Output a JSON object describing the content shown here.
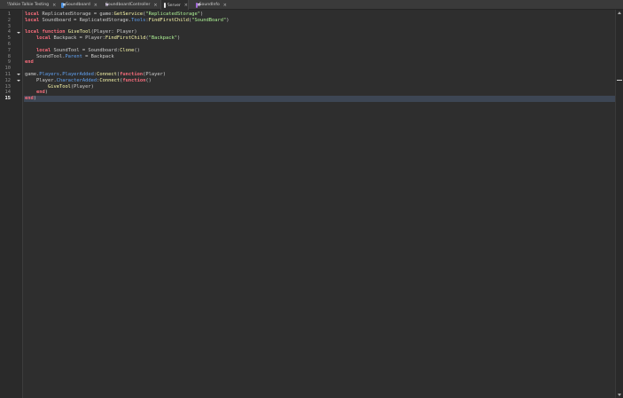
{
  "tabs": [
    {
      "label": "Walkie Talkie Testing",
      "icon": "script-icon",
      "close": "×"
    },
    {
      "label": "Soundboard",
      "icon": "local-script-icon",
      "close": "×"
    },
    {
      "label": "SoundboardController",
      "icon": "module-script-icon",
      "close": "×"
    },
    {
      "label": "Server",
      "icon": "script-icon",
      "close": "×",
      "active": true
    },
    {
      "label": "SoundInfo",
      "icon": "module-script-icon",
      "close": "×"
    }
  ],
  "editor": {
    "current_line": 15,
    "line_numbers": [
      "1",
      "2",
      "3",
      "4",
      "5",
      "6",
      "7",
      "8",
      "9",
      "10",
      "11",
      "12",
      "13",
      "14",
      "15"
    ],
    "lines": [
      [
        [
          "kw",
          "local"
        ],
        [
          "pl",
          " ReplicatedStorage = "
        ],
        [
          "pl",
          "game"
        ],
        [
          "pl",
          ":"
        ],
        [
          "fn",
          "GetService"
        ],
        [
          "pl",
          "("
        ],
        [
          "str",
          "\"ReplicatedStorage\""
        ],
        [
          "pl",
          ")"
        ]
      ],
      [
        [
          "kw",
          "local"
        ],
        [
          "pl",
          " Soundboard = ReplicatedStorage."
        ],
        [
          "prop",
          "Tools"
        ],
        [
          "pl",
          ":"
        ],
        [
          "fn",
          "FindFirstChild"
        ],
        [
          "pl",
          "("
        ],
        [
          "str",
          "\"SoundBoard\""
        ],
        [
          "pl",
          ")"
        ]
      ],
      [],
      [
        [
          "kw",
          "local"
        ],
        [
          "pl",
          " "
        ],
        [
          "kw",
          "function"
        ],
        [
          "pl",
          " "
        ],
        [
          "fn",
          "GiveTool"
        ],
        [
          "pl",
          "(Player: Player)"
        ]
      ],
      [
        [
          "pl",
          "    "
        ],
        [
          "kw",
          "local"
        ],
        [
          "pl",
          " Backpack = Player:"
        ],
        [
          "fn",
          "FindFirstChild"
        ],
        [
          "pl",
          "("
        ],
        [
          "str",
          "\"Backpack\""
        ],
        [
          "pl",
          ")"
        ]
      ],
      [],
      [
        [
          "pl",
          "    "
        ],
        [
          "kw",
          "local"
        ],
        [
          "pl",
          " SoundTool = Soundboard:"
        ],
        [
          "fn",
          "Clone"
        ],
        [
          "pl",
          "()"
        ]
      ],
      [
        [
          "pl",
          "    SoundTool."
        ],
        [
          "prop",
          "Parent"
        ],
        [
          "pl",
          " = Backpack"
        ]
      ],
      [
        [
          "kw",
          "end"
        ]
      ],
      [],
      [
        [
          "pl",
          "game."
        ],
        [
          "prop",
          "Players"
        ],
        [
          "pl",
          "."
        ],
        [
          "prop",
          "PlayerAdded"
        ],
        [
          "pl",
          ":"
        ],
        [
          "fn",
          "Connect"
        ],
        [
          "pl",
          "("
        ],
        [
          "kw",
          "function"
        ],
        [
          "pl",
          "(Player)"
        ]
      ],
      [
        [
          "pl",
          "    Player."
        ],
        [
          "prop",
          "CharacterAdded"
        ],
        [
          "pl",
          ":"
        ],
        [
          "fn",
          "Connect"
        ],
        [
          "pl",
          "("
        ],
        [
          "kw",
          "function"
        ],
        [
          "pl",
          "()"
        ]
      ],
      [
        [
          "pl",
          "        "
        ],
        [
          "fn",
          "GiveTool"
        ],
        [
          "pl",
          "(Player)"
        ]
      ],
      [
        [
          "pl",
          "    "
        ],
        [
          "kw",
          "end"
        ],
        [
          "pl",
          ")"
        ]
      ],
      [
        [
          "kw",
          "end"
        ],
        [
          "pl",
          ")"
        ]
      ]
    ]
  }
}
